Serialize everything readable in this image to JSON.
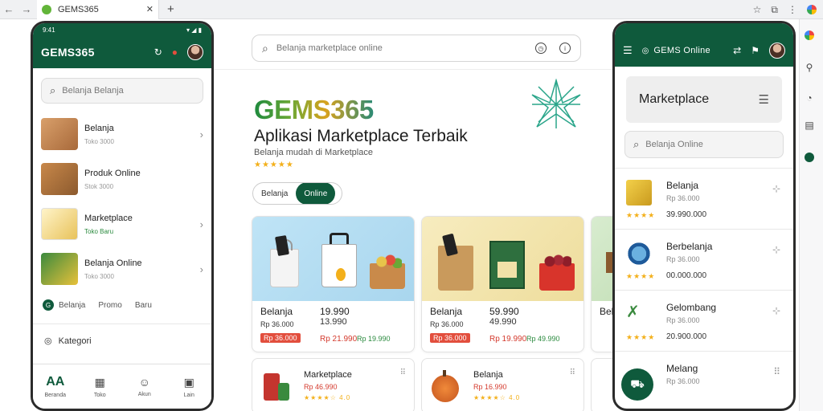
{
  "browser": {
    "tab_title": "GEMS365",
    "back": "←",
    "forward": "→",
    "close": "✕",
    "new_tab": "+"
  },
  "left_phone": {
    "status_time": "9:41",
    "status_icons": "▾ ◢ ▮",
    "app_title": "GEMS365",
    "search_placeholder": "Belanja Belanja",
    "items": [
      {
        "name": "Belanja",
        "sub": "Toko 3000",
        "color": "#c98a4a"
      },
      {
        "name": "Produk Online",
        "sub": "Stok 3000",
        "color": "#b87a3e"
      },
      {
        "name": "Marketplace",
        "sub": "Toko Baru",
        "color": "#f0c75e"
      },
      {
        "name": "Belanja Online",
        "sub": "Toko 3000",
        "color": "#2e7a3a"
      }
    ],
    "links": [
      "Belanja",
      "Promo",
      "Baru"
    ],
    "section": "Kategori",
    "nav": [
      {
        "label": "Beranda",
        "icon": "AA"
      },
      {
        "label": "Toko",
        "icon": "▦"
      },
      {
        "label": "Akun",
        "icon": "☺"
      },
      {
        "label": "Lain",
        "icon": "▣"
      }
    ]
  },
  "center": {
    "search_placeholder": "Belanja marketplace online",
    "brand": "GEMS365",
    "headline": "Aplikasi Marketplace Terbaik",
    "subline": "Belanja mudah di Marketplace",
    "rating": "★★★★★",
    "toggle": [
      "Belanja",
      "Online"
    ],
    "cards": [
      {
        "title": "Belanja",
        "price": "19.990",
        "sub": "Rp 36.000",
        "price2": "13.990",
        "badge": "Rp 36.000",
        "red": "Rp 21.990",
        "green": "Rp 19.990"
      },
      {
        "title": "Belanja",
        "price": "59.990",
        "sub": "Rp 36.000",
        "price2": "49.990",
        "badge": "Rp 36.000",
        "red": "Rp 19.990",
        "green": "Rp 49.990"
      },
      {
        "title": "Belanja",
        "price": "",
        "sub": "",
        "price2": "",
        "badge": "",
        "red": "",
        "green": ""
      }
    ],
    "small_cards": [
      {
        "title": "Marketplace",
        "red": "Rp 46.990",
        "stars": "★★★★☆ 4.0"
      },
      {
        "title": "Belanja",
        "red": "Rp 16.990",
        "stars": "★★★★☆ 4.0"
      },
      {
        "title": "",
        "red": "",
        "stars": ""
      }
    ]
  },
  "right_phone": {
    "app_title": "GEMS Online",
    "header_title": "Marketplace",
    "search_placeholder": "Belanja Online",
    "items": [
      {
        "name": "Belanja",
        "sub": "Rp 36.000",
        "price": "39.990.000",
        "stars": "★★★★"
      },
      {
        "name": "Berbelanja",
        "sub": "Rp 36.000",
        "price": "00.000.000",
        "stars": "★★★★"
      },
      {
        "name": "Gelombang",
        "sub": "Rp 36.000",
        "price": "20.900.000",
        "stars": "★★★★"
      },
      {
        "name": "Melang",
        "sub": "Rp 36.000",
        "price": "",
        "stars": ""
      }
    ]
  },
  "colors": {
    "primary": "#0f5a3c",
    "star": "#f3b01b",
    "price_red": "#d43a2d"
  }
}
